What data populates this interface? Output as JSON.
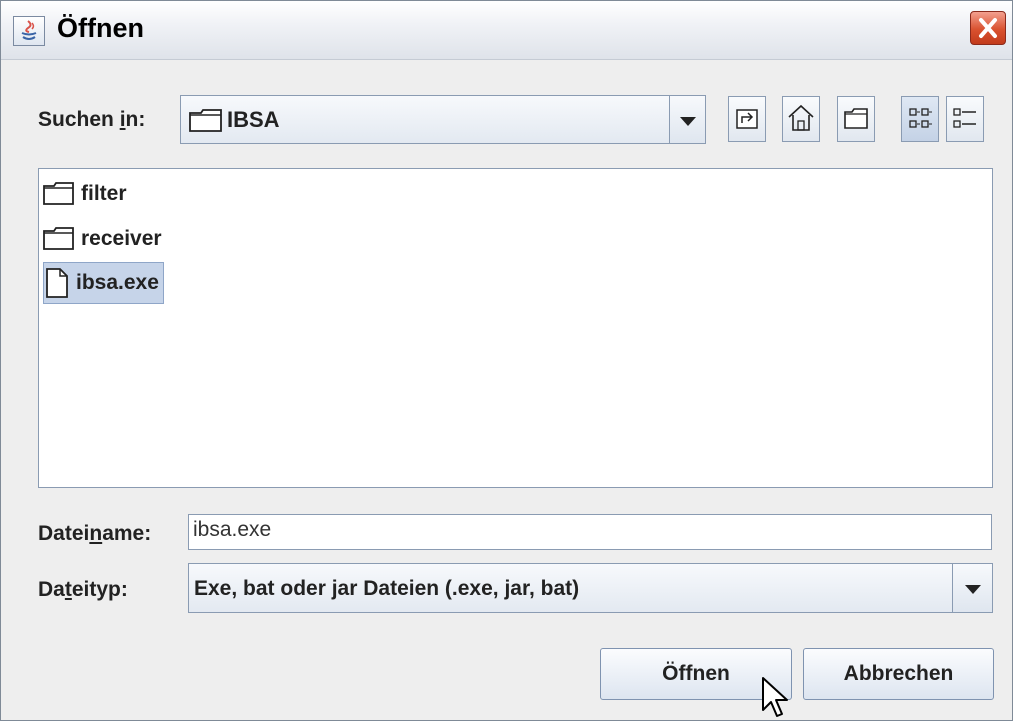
{
  "window": {
    "title": "Öffnen"
  },
  "look_in": {
    "label_pre": "Suchen ",
    "label_mnemonic": "i",
    "label_post": "n:",
    "value": "IBSA"
  },
  "toolbar": {
    "icons": [
      "up-folder-icon",
      "home-icon",
      "new-folder-icon",
      "list-view-icon",
      "details-view-icon"
    ]
  },
  "files": [
    {
      "name": "filter",
      "type": "folder"
    },
    {
      "name": "receiver",
      "type": "folder"
    },
    {
      "name": "ibsa.exe",
      "type": "file",
      "selected": true
    }
  ],
  "filename": {
    "label_pre": "Datei",
    "label_mnemonic": "n",
    "label_post": "ame:",
    "value": "ibsa.exe"
  },
  "filetype": {
    "label_pre": "Da",
    "label_mnemonic": "t",
    "label_post": "eityp:",
    "value": "Exe, bat oder jar Dateien (.exe, jar, bat)"
  },
  "buttons": {
    "open": "Öffnen",
    "cancel": "Abbrechen"
  },
  "colors": {
    "selection": "#c6d4e9",
    "border": "#8a9bb2",
    "close": "#d9512f"
  }
}
